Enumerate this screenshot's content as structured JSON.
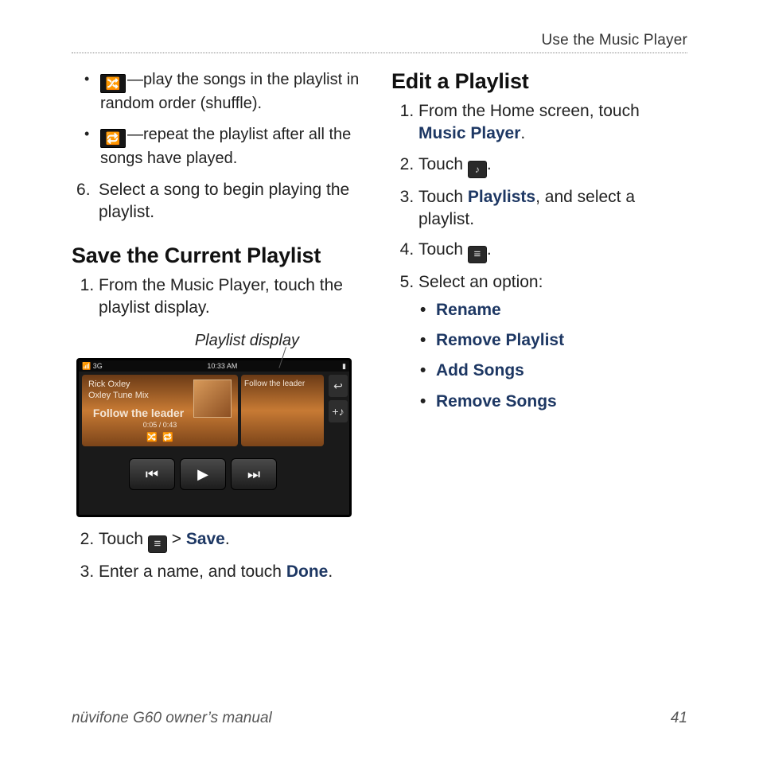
{
  "running_head": "Use the Music Player",
  "left": {
    "shuffle_desc": "—play the songs in the playlist in random order (shuffle).",
    "repeat_desc": "—repeat the playlist after all the songs have played.",
    "step6": "Select a song to begin playing the playlist.",
    "h_save": "Save the Current Playlist",
    "save1": "From the Music Player, touch the playlist display.",
    "fig_caption": "Playlist display",
    "save2_pre": "Touch ",
    "save2_mid": " > ",
    "save2_link": "Save",
    "save2_end": ".",
    "save3_pre": "Enter a name, and touch ",
    "save3_link": "Done",
    "save3_end": "."
  },
  "device": {
    "signal": "3G",
    "time": "10:33 AM",
    "batt": "▮",
    "artist": "Rick Oxley",
    "album": "Oxley Tune Mix",
    "track": "Follow the leader",
    "elapsed": "0:05 / 0:43",
    "right_title": "Follow the leader"
  },
  "right": {
    "h_edit": "Edit a Playlist",
    "e1_pre": "From the Home screen, touch ",
    "e1_link": "Music Player",
    "e1_end": ".",
    "e2_pre": "Touch ",
    "e2_end": ".",
    "e3_pre": "Touch ",
    "e3_link": "Playlists",
    "e3_end": ", and select a playlist.",
    "e4_pre": "Touch ",
    "e4_end": ".",
    "e5": "Select an option:",
    "opts": {
      "o1": "Rename",
      "o2": "Remove Playlist",
      "o3": "Add Songs",
      "o4": "Remove Songs"
    }
  },
  "footer": {
    "left": "nüvifone G60 owner’s manual",
    "page": "41"
  }
}
